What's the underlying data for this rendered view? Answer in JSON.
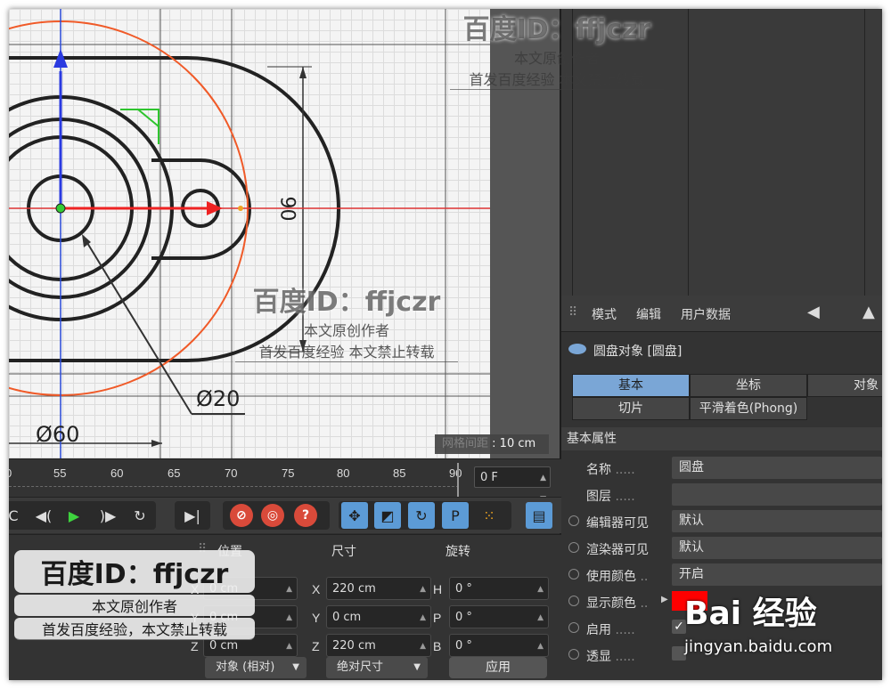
{
  "viewport": {
    "dim_labels": {
      "height": "90",
      "small_dia": "Ø20",
      "large_dia": "Ø60"
    },
    "grid_status": "网格间距 : 10 cm",
    "grid_status_prefix": "网格间距",
    "grid_status_value": ": 10 cm"
  },
  "timeline": {
    "ticks": [
      "0",
      "55",
      "60",
      "65",
      "70",
      "75",
      "80",
      "85",
      "90"
    ],
    "current_frame": "0 F"
  },
  "toolbar": {
    "buttons": [
      "prev-key",
      "play-back",
      "play",
      "play-forward",
      "loop",
      "go-end",
      "record-key",
      "auto-key",
      "help",
      "move",
      "scale",
      "rotate",
      "param",
      "points",
      "film"
    ]
  },
  "coord": {
    "headers": {
      "pos": "位置",
      "size": "尺寸",
      "rot": "旋转"
    },
    "pos_axes": [
      "X",
      "Y",
      "Z"
    ],
    "pos": [
      "0 cm",
      "0 cm",
      "0 cm"
    ],
    "size_axes": [
      "X",
      "Y",
      "Z"
    ],
    "size": [
      "220 cm",
      "0 cm",
      "220 cm"
    ],
    "rot_axes": [
      "H",
      "P",
      "B"
    ],
    "rot": [
      "0 °",
      "0 °",
      "0 °"
    ],
    "mode_dropdown": "对象 (相对)",
    "size_dropdown": "绝对尺寸",
    "apply": "应用"
  },
  "attributes": {
    "menu": [
      "模式",
      "编辑",
      "用户数据"
    ],
    "object_title": "圆盘对象 [圆盘]",
    "tabs_row1": [
      "基本",
      "坐标",
      "对象"
    ],
    "tabs_row2": [
      "切片",
      "平滑着色(Phong)"
    ],
    "section": "基本属性",
    "props": [
      {
        "label": "名称",
        "dots": " .....",
        "value": "圆盘"
      },
      {
        "label": "图层",
        "dots": " .....",
        "value": ""
      },
      {
        "label": "编辑器可见",
        "dots": "",
        "value": "默认"
      },
      {
        "label": "渲染器可见",
        "dots": "",
        "value": "默认"
      },
      {
        "label": "使用颜色",
        "dots": " ..",
        "value": "开启"
      },
      {
        "label": "显示颜色",
        "dots": " ..",
        "value": ""
      },
      {
        "label": "启用",
        "dots": " .....",
        "value": "✓"
      },
      {
        "label": "透显",
        "dots": " .....",
        "value": ""
      }
    ],
    "display_color": "#ff0000",
    "active_tab_color": "#7aa6d6"
  },
  "watermarks": {
    "id_text": "百度ID：ffjczr",
    "line1": "本文原创作者",
    "line2": "首发百度经验  本文禁止转载",
    "line2_b": "首发百度经验，本文禁止转载"
  },
  "baidu": {
    "logo": "Bai 经验",
    "site": "jingyan.baidu.com"
  }
}
